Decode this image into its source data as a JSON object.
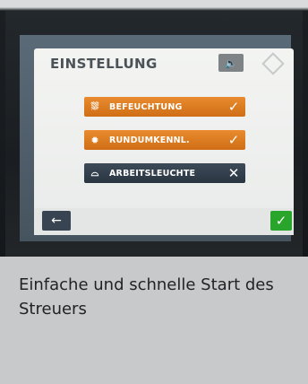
{
  "screen": {
    "title": "EINSTELLUNG",
    "speaker_icon": "speaker-icon",
    "buttons": [
      {
        "icon": "humidifier-icon",
        "label": "BEFEUCHTUNG",
        "status": "✓",
        "color": "#e07e24"
      },
      {
        "icon": "beacon-light-icon",
        "label": "RUNDUMKENNL.",
        "status": "✓",
        "color": "#e07e24"
      },
      {
        "icon": "work-light-icon",
        "label": "ARBEITSLEUCHTE",
        "status": "✕",
        "color": "#334150"
      }
    ],
    "back_icon": "←",
    "confirm_icon": "✓"
  },
  "caption": {
    "text": "Einfache und schnelle Start des Streuers"
  }
}
